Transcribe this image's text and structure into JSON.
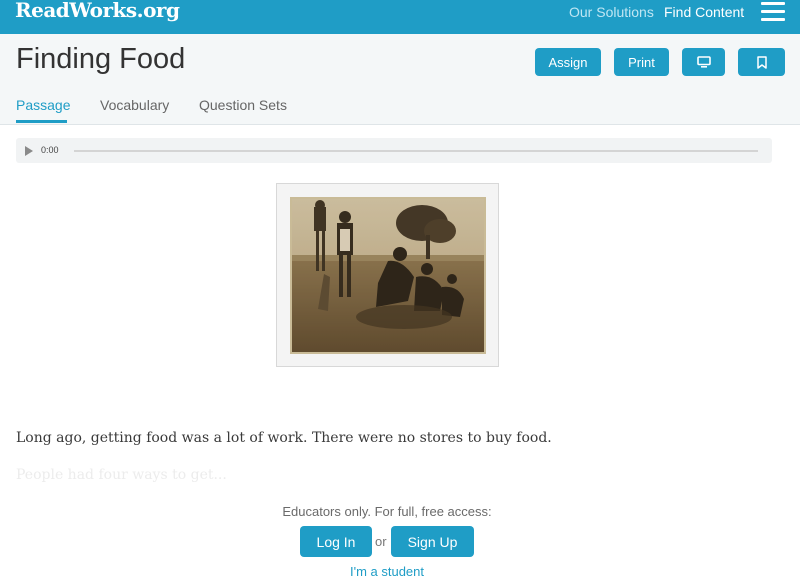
{
  "header": {
    "logo": "ReadWorks.org",
    "nav": {
      "solutions": "Our Solutions",
      "find_content": "Find Content"
    },
    "menu_icon": "hamburger-menu-icon"
  },
  "title_bar": {
    "title": "Finding Food",
    "buttons": {
      "assign": "Assign",
      "print": "Print",
      "present_icon": "monitor-icon",
      "save_icon": "bookmark-icon"
    },
    "tabs": [
      "Passage",
      "Vocabulary",
      "Question Sets"
    ],
    "active_tab": "Passage"
  },
  "audio": {
    "time": "0:00",
    "icon": "play-icon"
  },
  "passage": {
    "line1": "Long ago, getting food was a lot of work. There were no stores to buy food.",
    "line2_faded": "People had four ways to get..."
  },
  "access": {
    "prompt": "Educators only. For full, free access:",
    "login": "Log In",
    "or": "or",
    "signup": "Sign Up",
    "student": "I'm a student"
  },
  "colors": {
    "accent": "#1f9dc6",
    "title_bar_bg": "#f4f7f8"
  }
}
